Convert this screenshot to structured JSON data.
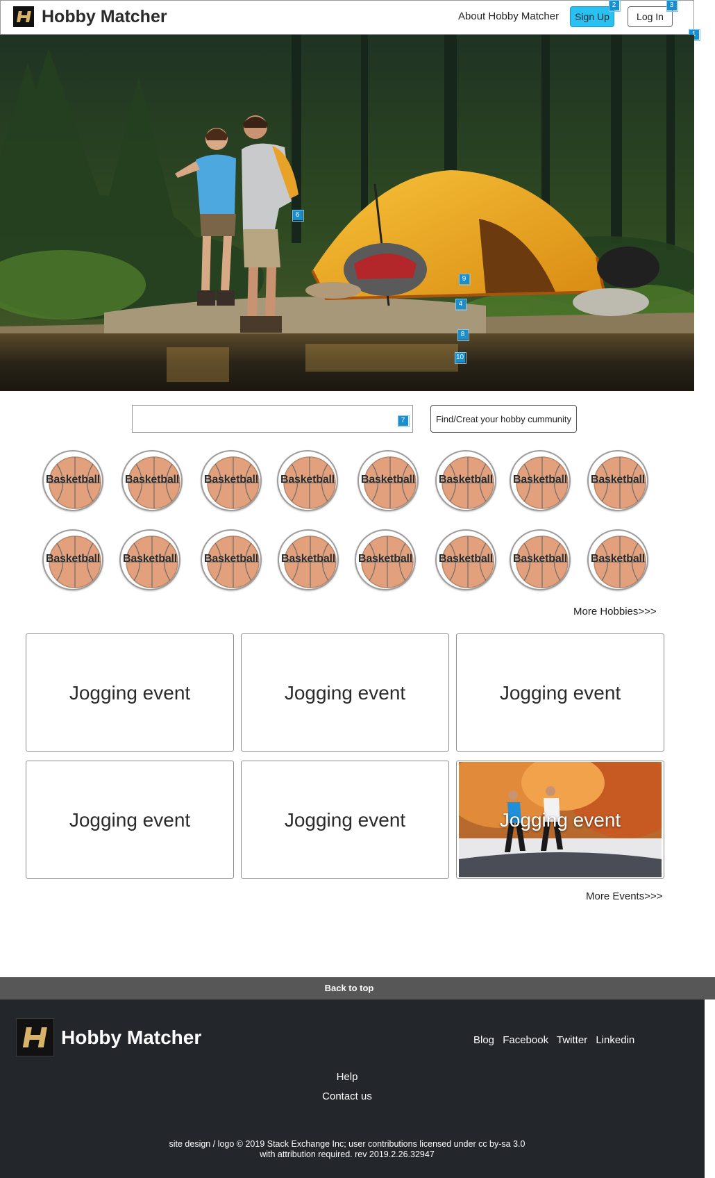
{
  "header": {
    "title": "Hobby Matcher",
    "about_label": "About Hobby Matcher",
    "signup_label": "Sign Up",
    "login_label": "Log In"
  },
  "markers": [
    "1",
    "2",
    "3",
    "4",
    "6",
    "7",
    "8",
    "9",
    "10"
  ],
  "search": {
    "value": "",
    "placeholder": "",
    "button_label": "Find/Creat  your hobby cummunity"
  },
  "hobbies": [
    {
      "label": "Basketball"
    },
    {
      "label": "Basketball"
    },
    {
      "label": "Basketball"
    },
    {
      "label": "Basketball"
    },
    {
      "label": "Basketball"
    },
    {
      "label": "Basketball"
    },
    {
      "label": "Basketball"
    },
    {
      "label": "Basketball"
    },
    {
      "label": "Basketball"
    },
    {
      "label": "Basketball"
    },
    {
      "label": "Basketball"
    },
    {
      "label": "Basketball"
    },
    {
      "label": "Basketball"
    },
    {
      "label": "Basketball"
    },
    {
      "label": "Basketball"
    },
    {
      "label": "Basketball"
    }
  ],
  "more_hobbies_label": "More Hobbies>>>",
  "events": [
    {
      "label": "Jogging event"
    },
    {
      "label": "Jogging event"
    },
    {
      "label": "Jogging event"
    },
    {
      "label": "Jogging event"
    },
    {
      "label": "Jogging event"
    },
    {
      "label": "Jogging event"
    }
  ],
  "more_events_label": "More Events>>>",
  "footer": {
    "back_to_top": "Back to top",
    "title": "Hobby Matcher",
    "links": [
      "Blog",
      "Facebook",
      "Twitter",
      "Linkedin"
    ],
    "help": "Help",
    "contact": "Contact us",
    "copyright_line1": "site design / logo © 2019 Stack Exchange Inc; user contributions licensed under cc by-sa 3.0",
    "copyright_line2": "with attribution required. rev 2019.2.26.32947"
  },
  "colors": {
    "signup_accent": "#29c1f1",
    "marker": "#1a8fd0",
    "footer_bg": "#23262b",
    "back_to_top_bg": "#575757"
  }
}
